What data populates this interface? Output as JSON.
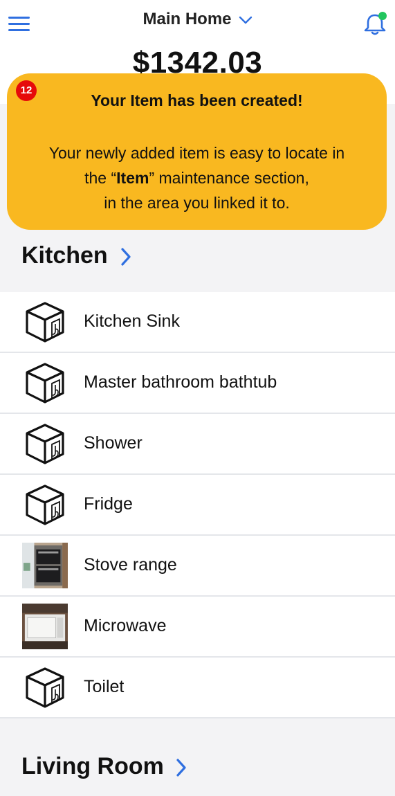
{
  "header": {
    "home_name": "Main Home",
    "balance": "$1342.03"
  },
  "tooltip": {
    "step_number": "12",
    "title": "Your Item has been created!",
    "body_line1": "Your newly added item is easy to locate in",
    "body_line2_pre": "the “",
    "body_line2_bold": "Item",
    "body_line2_post": "” maintenance section,",
    "body_line3": "in the area you linked it to."
  },
  "sections": [
    {
      "name": "Kitchen",
      "items": [
        {
          "label": "Kitchen Sink",
          "icon": "box-icon"
        },
        {
          "label": "Master bathroom bathtub",
          "icon": "box-icon"
        },
        {
          "label": "Shower",
          "icon": "box-icon"
        },
        {
          "label": "Fridge",
          "icon": "box-icon"
        },
        {
          "label": "Stove range",
          "icon": "stove-photo"
        },
        {
          "label": "Microwave",
          "icon": "microwave-photo"
        },
        {
          "label": "Toilet",
          "icon": "box-icon"
        }
      ]
    },
    {
      "name": "Living Room",
      "items": []
    }
  ],
  "colors": {
    "accent": "#2f6fe0",
    "tooltip_bg": "#f9b820",
    "badge": "#e60a0a",
    "notification_dot": "#22c55e"
  }
}
